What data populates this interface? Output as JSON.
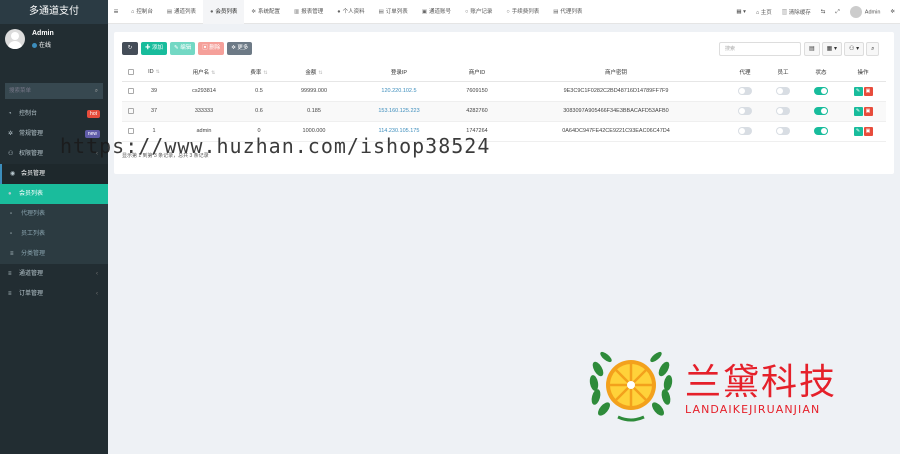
{
  "app": {
    "title": "多通道支付"
  },
  "user": {
    "name": "Admin",
    "status": "在线"
  },
  "sidebar": {
    "search_placeholder": "搜索菜单",
    "items": [
      {
        "label": "控制台",
        "icon": "dashboard-icon",
        "badge": "hot",
        "badge_color": "#e74c3c"
      },
      {
        "label": "常规管理",
        "icon": "cogs-icon",
        "badge": "new",
        "badge_color": "#605ca8"
      },
      {
        "label": "权限管理",
        "icon": "group-icon",
        "caret": "‹"
      },
      {
        "label": "会员管理",
        "icon": "user-circle-icon"
      },
      {
        "label": "会员列表",
        "icon": "user-icon"
      },
      {
        "label": "代理列表",
        "icon": "file-icon"
      },
      {
        "label": "员工列表",
        "icon": "file-icon"
      },
      {
        "label": "分类管理",
        "icon": "list-icon"
      },
      {
        "label": "通道管理",
        "icon": "list-icon",
        "caret": "‹"
      },
      {
        "label": "订单管理",
        "icon": "list-icon",
        "caret": "‹"
      }
    ]
  },
  "tabs": [
    {
      "label": "控制台",
      "icon": "⌂"
    },
    {
      "label": "通道列表",
      "icon": "▤"
    },
    {
      "label": "会员列表",
      "icon": "●"
    },
    {
      "label": "系统配置",
      "icon": "✲"
    },
    {
      "label": "报表管理",
      "icon": "▥"
    },
    {
      "label": "个人资料",
      "icon": "●"
    },
    {
      "label": "订单列表",
      "icon": "▤"
    },
    {
      "label": "通道账号",
      "icon": "▣"
    },
    {
      "label": "账户记录",
      "icon": "○"
    },
    {
      "label": "手续费列表",
      "icon": "○"
    },
    {
      "label": "代理列表",
      "icon": "▤"
    }
  ],
  "topright": {
    "home": "主页",
    "clear": "清除缓存",
    "admin": "Admin"
  },
  "toolbar": {
    "add": "添加",
    "edit": "编辑",
    "delete": "删除",
    "more": "更多"
  },
  "search": {
    "placeholder": "搜索"
  },
  "table": {
    "columns": [
      "ID",
      "用户名",
      "费率",
      "金额",
      "登录IP",
      "商户ID",
      "商户密钥",
      "代理",
      "员工",
      "状态",
      "操作"
    ],
    "rows": [
      {
        "id": "39",
        "username": "cs293814",
        "rate": "0.5",
        "amount": "99999.000",
        "ip": "120.220.102.5",
        "merchant_id": "7609150",
        "key": "9E3C9C1F0282C2BD48716D14789FF7F9",
        "agent": false,
        "staff": false,
        "status": true
      },
      {
        "id": "37",
        "username": "333333",
        "rate": "0.6",
        "amount": "0.185",
        "ip": "153.160.125.223",
        "merchant_id": "4282760",
        "key": "3083097A905466F34E3BBACAFD53AFB0",
        "agent": false,
        "staff": false,
        "status": true
      },
      {
        "id": "1",
        "username": "admin",
        "rate": "0",
        "amount": "1000.000",
        "ip": "114.230.105.175",
        "merchant_id": "1747264",
        "key": "0A64DC947FE42CE9221C93EAC06C47D4",
        "agent": false,
        "staff": false,
        "status": true
      }
    ]
  },
  "pagination": {
    "info": "显示第 1 到第 3 条记录，总共 3 条记录"
  },
  "watermark": {
    "text": "https://www.huzhan.com/ishop38524"
  },
  "brand": {
    "name": "兰黛科技",
    "sub": "LANDAIKEJIRUANJIAN"
  }
}
